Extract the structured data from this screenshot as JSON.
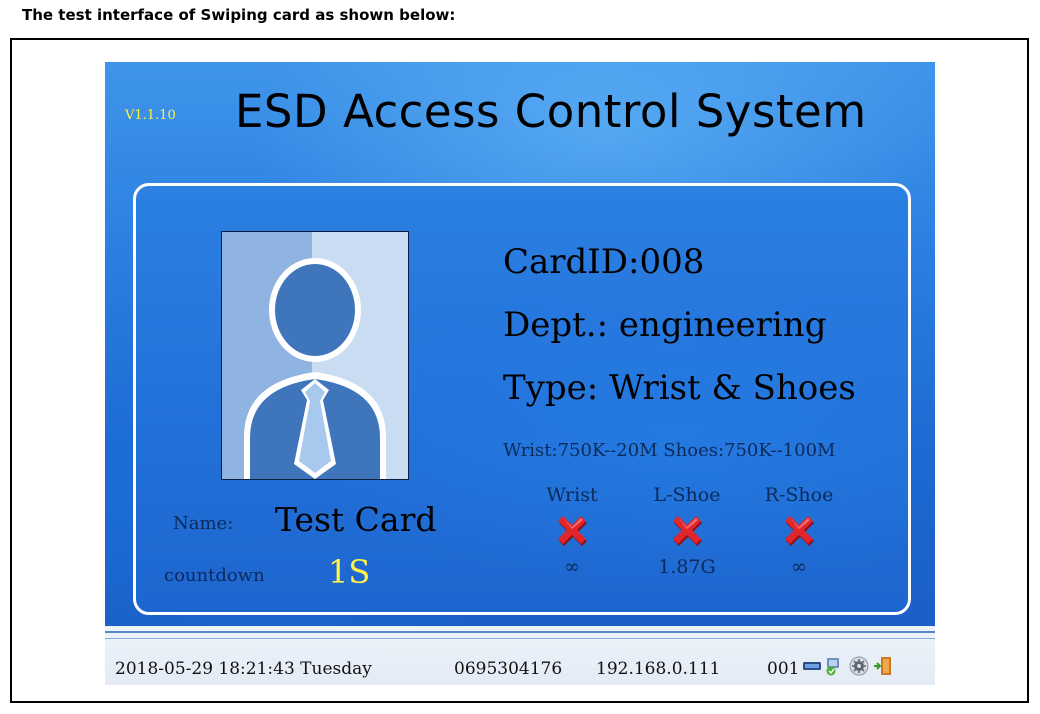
{
  "caption": "The test interface of Swiping card as shown below:",
  "app": {
    "version": "V1.1.10",
    "title": "ESD Access Control System"
  },
  "card": {
    "card_id": "CardID:008",
    "dept": "Dept.: engineering",
    "type": "Type: Wrist & Shoes",
    "spec": "Wrist:750K--20M  Shoes:750K--100M",
    "name_label": "Name:",
    "name_value": "Test Card",
    "countdown_label": "countdown",
    "countdown_value": "1S"
  },
  "meters": [
    {
      "label": "Wrist",
      "status": "fail",
      "value": "∞"
    },
    {
      "label": "L-Shoe",
      "status": "fail",
      "value": "1.87G"
    },
    {
      "label": "R-Shoe",
      "status": "fail",
      "value": "∞"
    }
  ],
  "status_bar": {
    "datetime": "2018-05-29 18:21:43 Tuesday",
    "serial": "0695304176",
    "ip": "192.168.0.111",
    "device_no": "001",
    "icons": [
      "card-reader-icon",
      "network-icon",
      "settings-icon",
      "exit-icon"
    ]
  },
  "colors": {
    "accent_yellow": "#fff34a",
    "screen_blue": "#2b7ee0",
    "fail_red": "#e0262a"
  }
}
